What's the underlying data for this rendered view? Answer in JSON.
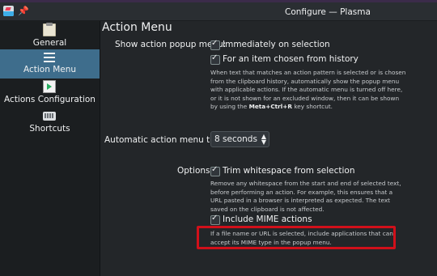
{
  "window": {
    "title": "Configure — Plasma",
    "app_icon": "klipper-icon",
    "pin_icon": "pin-icon"
  },
  "sidebar": {
    "items": [
      {
        "label": "General",
        "icon": "general-icon",
        "selected": false
      },
      {
        "label": "Action Menu",
        "icon": "hamburger-menu-icon",
        "selected": true
      },
      {
        "label": "Actions Configuration",
        "icon": "actions-icon",
        "selected": false
      },
      {
        "label": "Shortcuts",
        "icon": "keyboard-icon",
        "selected": false
      }
    ]
  },
  "page": {
    "heading": "Action Menu",
    "show_popup_label": "Show action popup menu:",
    "immediately_label": "Immediately on selection",
    "history_label": "For an item chosen from history",
    "popup_help_line1": "When text that matches an action pattern is selected or is chosen",
    "popup_help_line2": "from the clipboard history, automatically show the popup menu",
    "popup_help_line3": "with applicable actions. If the automatic menu is turned off here,",
    "popup_help_line4": "or it is not shown for an excluded window, then it can be shown",
    "popup_help_line5_pre": "by using the ",
    "popup_help_shortcut": "Meta+Ctrl+R",
    "popup_help_line5_post": " key shortcut.",
    "auto_time_label": "Automatic action menu time:",
    "auto_time_value": "8 seconds",
    "options_label": "Options:",
    "trim_label": "Trim whitespace from selection",
    "trim_help_line1": "Remove any whitespace from the start and end of selected text,",
    "trim_help_line2": "before performing an action. For example, this ensures that a",
    "trim_help_line3": "URL pasted in a browser is interpreted as expected. The text",
    "trim_help_line4": "saved on the clipboard is not affected.",
    "mime_label": "Include MIME actions",
    "mime_help_line1": "If a file name or URL is selected, include applications that can",
    "mime_help_line2": "accept its MIME type in the popup menu."
  },
  "colors": {
    "selection": "#3e6d8c",
    "highlight_box": "#d1101a"
  }
}
